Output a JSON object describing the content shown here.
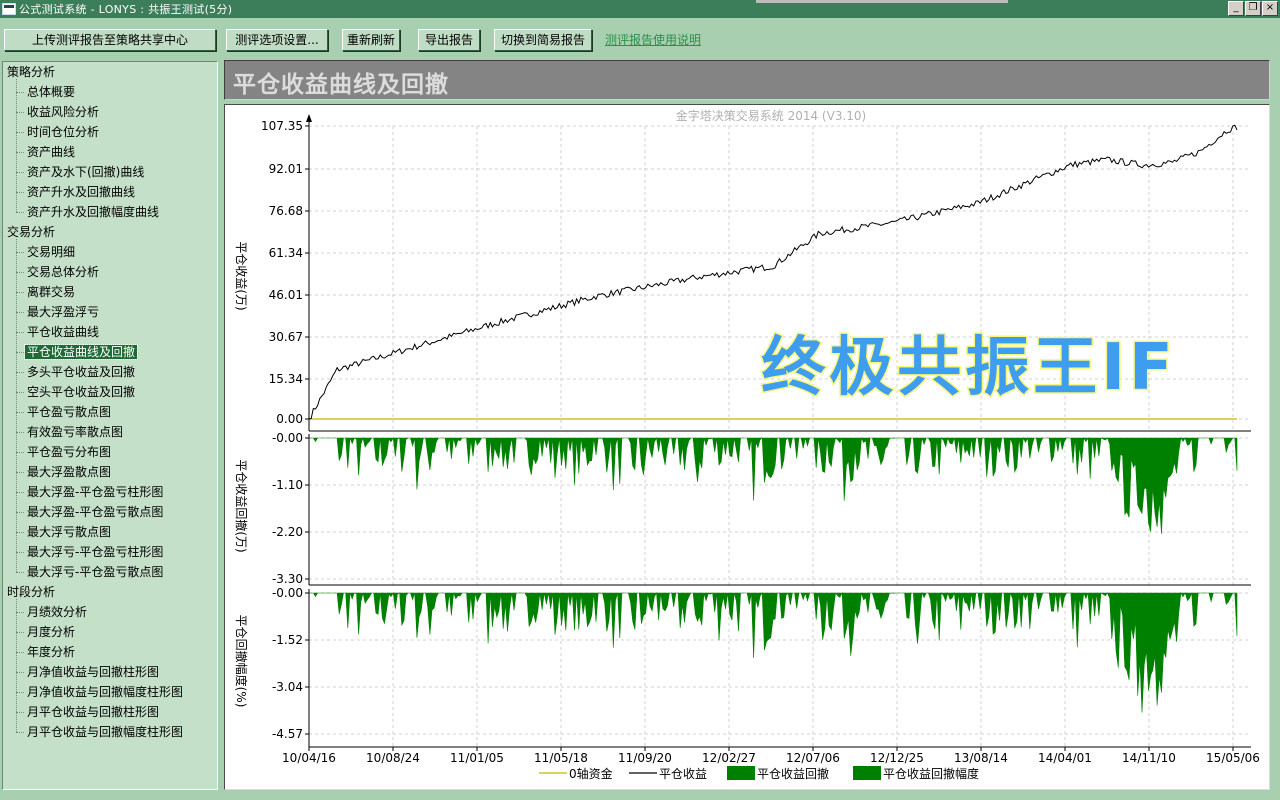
{
  "window": {
    "title": "公式测试系统 - LONYS : 共振王测试(5分)",
    "buttons": {
      "minimize": "_",
      "restore": "❐",
      "close": "×"
    }
  },
  "toolbar": {
    "upload": "上传测评报告至策略共享中心",
    "settings": "测评选项设置...",
    "refresh": "重新刷新",
    "export": "导出报告",
    "switch": "切换到简易报告",
    "help_link": "测评报告使用说明"
  },
  "sidebar": {
    "groups": [
      {
        "label": "策略分析",
        "items": [
          "总体概要",
          "收益风险分析",
          "时间仓位分析",
          "资产曲线",
          "资产及水下(回撤)曲线",
          "资产升水及回撤曲线",
          "资产升水及回撤幅度曲线"
        ]
      },
      {
        "label": "交易分析",
        "items": [
          "交易明细",
          "交易总体分析",
          "离群交易",
          "最大浮盈浮亏",
          "平仓收益曲线",
          "平仓收益曲线及回撤",
          "多头平仓收益及回撤",
          "空头平仓收益及回撤",
          "平仓盈亏散点图",
          "有效盈亏率散点图",
          "平仓盈亏分布图",
          "最大浮盈散点图",
          "最大浮盈-平仓盈亏柱形图",
          "最大浮盈-平仓盈亏散点图",
          "最大浮亏散点图",
          "最大浮亏-平仓盈亏柱形图",
          "最大浮亏-平仓盈亏散点图"
        ]
      },
      {
        "label": "时段分析",
        "items": [
          "月绩效分析",
          "月度分析",
          "年度分析",
          "月净值收益与回撤柱形图",
          "月净值收益与回撤幅度柱形图",
          "月平仓收益与回撤柱形图",
          "月平仓收益与回撤幅度柱形图"
        ]
      }
    ],
    "selected": "平仓收益曲线及回撤"
  },
  "header": {
    "title": "平仓收益曲线及回撤"
  },
  "watermark": "终极共振王IF",
  "chart_data": {
    "type": "line",
    "subtitle": "金字塔决策交易系统 2014 (V3.10)",
    "x_ticks": [
      "10/04/16",
      "10/08/24",
      "11/01/05",
      "11/05/18",
      "11/09/20",
      "12/02/27",
      "12/07/06",
      "12/12/25",
      "13/08/14",
      "14/04/01",
      "14/11/10",
      "15/05/06"
    ],
    "legend": [
      {
        "name": "0轴资金",
        "color": "#c8b400",
        "kind": "line"
      },
      {
        "name": "平仓收益",
        "color": "#000000",
        "kind": "line"
      },
      {
        "name": "平仓收益回撤",
        "color": "#008000",
        "kind": "bar"
      },
      {
        "name": "平仓收益回撤幅度",
        "color": "#008000",
        "kind": "bar"
      }
    ],
    "panels": [
      {
        "ylabel": "平仓收益(万)",
        "yticks": [
          "107.35",
          "92.01",
          "76.68",
          "61.34",
          "46.01",
          "30.67",
          "15.34",
          "0.00"
        ],
        "ylim": [
          0,
          107.35
        ],
        "series": [
          {
            "name": "0轴资金",
            "color": "#c8b400",
            "values": [
              0,
              0,
              0,
              0,
              0,
              0,
              0,
              0,
              0,
              0,
              0,
              0
            ]
          },
          {
            "name": "平仓收益",
            "color": "#000000",
            "values": [
              0,
              18,
              24,
              35,
              45,
              52,
              56,
              68,
              72,
              79,
              93,
              95,
              93,
              94,
              98,
              106,
              107
            ],
            "x_frac": [
              0,
              0.03,
              0.09,
              0.2,
              0.31,
              0.42,
              0.5,
              0.55,
              0.63,
              0.72,
              0.82,
              0.86,
              0.9,
              0.93,
              0.96,
              0.99,
              1.0
            ]
          }
        ]
      },
      {
        "ylabel": "平仓收益回撤(万)",
        "yticks": [
          "-0.00",
          "-1.10",
          "-2.20",
          "-3.30"
        ],
        "ylim": [
          -3.3,
          0
        ],
        "series": [
          {
            "name": "平仓收益回撤",
            "color": "#008000"
          }
        ]
      },
      {
        "ylabel": "平仓回撤幅度(%)",
        "yticks": [
          "-0.00",
          "-1.52",
          "-3.04",
          "-4.57"
        ],
        "ylim": [
          -4.57,
          0
        ],
        "series": [
          {
            "name": "平仓收益回撤幅度",
            "color": "#008000"
          }
        ]
      }
    ]
  }
}
